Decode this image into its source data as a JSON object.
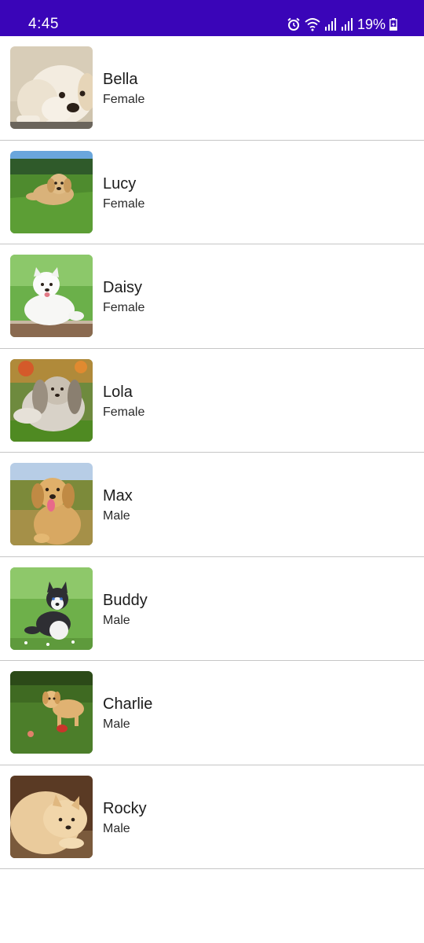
{
  "status_bar": {
    "time": "4:45",
    "battery": "19%",
    "color": "#3a05b8",
    "icons": [
      "alarm-icon",
      "wifi-icon",
      "signal-icon",
      "signal-icon",
      "battery-charging-icon"
    ]
  },
  "dogs": [
    {
      "name": "Bella",
      "gender": "Female",
      "photo": "golden-puppy-lying"
    },
    {
      "name": "Lucy",
      "gender": "Female",
      "photo": "golden-puppy-grass"
    },
    {
      "name": "Daisy",
      "gender": "Female",
      "photo": "white-samoyed-puppy"
    },
    {
      "name": "Lola",
      "gender": "Female",
      "photo": "shih-tzu-grass"
    },
    {
      "name": "Max",
      "gender": "Male",
      "photo": "golden-retriever-puppy"
    },
    {
      "name": "Buddy",
      "gender": "Male",
      "photo": "husky-puppy-meadow"
    },
    {
      "name": "Charlie",
      "gender": "Male",
      "photo": "puppy-playing-grass"
    },
    {
      "name": "Rocky",
      "gender": "Male",
      "photo": "pomeranian-lying"
    }
  ]
}
